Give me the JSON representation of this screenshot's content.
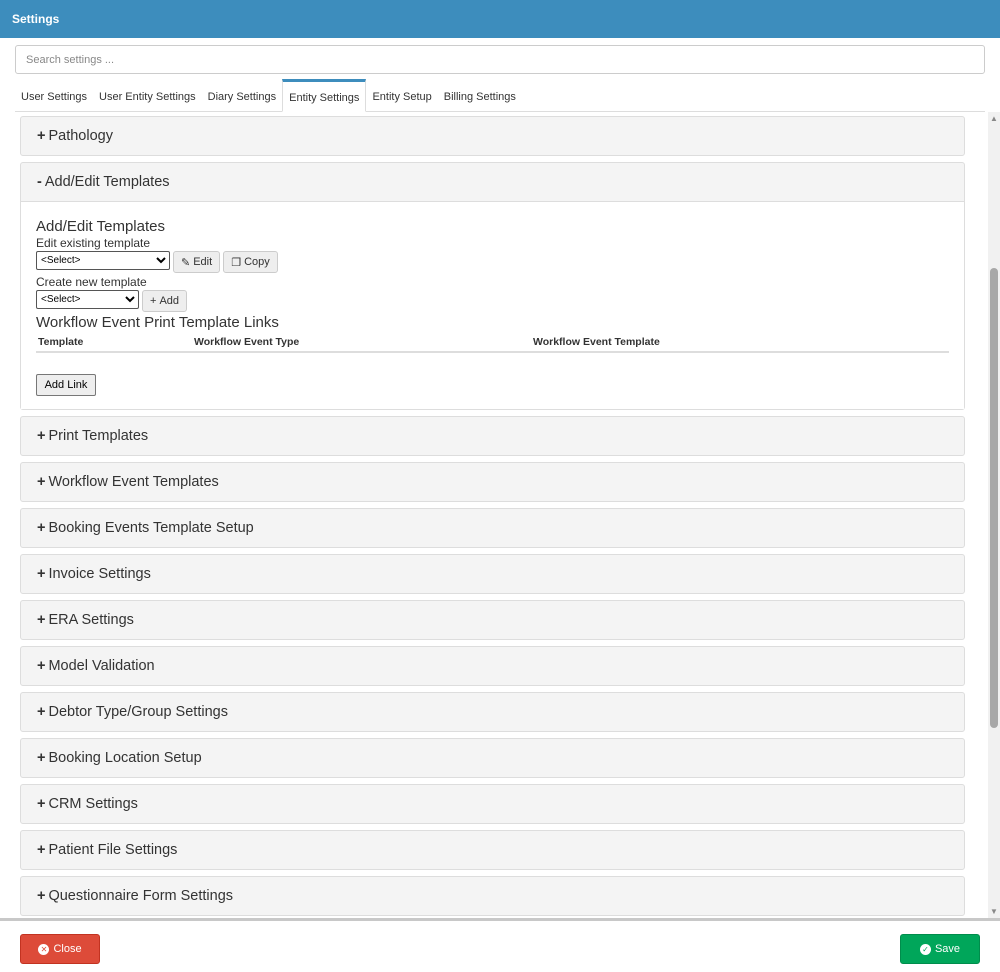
{
  "header": {
    "title": "Settings"
  },
  "search": {
    "placeholder": "Search settings ..."
  },
  "tabs": [
    "User Settings",
    "User Entity Settings",
    "Diary Settings",
    "Entity Settings",
    "Entity Setup",
    "Billing Settings"
  ],
  "panels_before": [
    {
      "sign": "+",
      "label": "Pathology"
    }
  ],
  "open_panel": {
    "sign": "-",
    "label": "Add/Edit Templates",
    "heading": "Add/Edit Templates",
    "edit_label": "Edit existing template",
    "edit_select": "<Select>",
    "edit_button": "Edit",
    "copy_button": "Copy",
    "create_label": "Create new template",
    "create_select": "<Select>",
    "add_button": "Add",
    "links_heading": "Workflow Event Print Template Links",
    "columns": [
      "Template",
      "Workflow Event Type",
      "Workflow Event Template"
    ],
    "add_link": "Add Link"
  },
  "panels_after": [
    {
      "sign": "+",
      "label": "Print Templates"
    },
    {
      "sign": "+",
      "label": "Workflow Event Templates"
    },
    {
      "sign": "+",
      "label": "Booking Events Template Setup"
    },
    {
      "sign": "+",
      "label": "Invoice Settings"
    },
    {
      "sign": "+",
      "label": "ERA Settings"
    },
    {
      "sign": "+",
      "label": "Model Validation"
    },
    {
      "sign": "+",
      "label": "Debtor Type/Group Settings"
    },
    {
      "sign": "+",
      "label": "Booking Location Setup"
    },
    {
      "sign": "+",
      "label": "CRM Settings"
    },
    {
      "sign": "+",
      "label": "Patient File Settings"
    },
    {
      "sign": "+",
      "label": "Questionnaire Form Settings"
    },
    {
      "sign": "",
      "label": ""
    }
  ],
  "footer": {
    "close": "Close",
    "save": "Save"
  },
  "colors": {
    "header": "#3d8dbd",
    "close": "#dd4b39",
    "save": "#00a65a"
  }
}
